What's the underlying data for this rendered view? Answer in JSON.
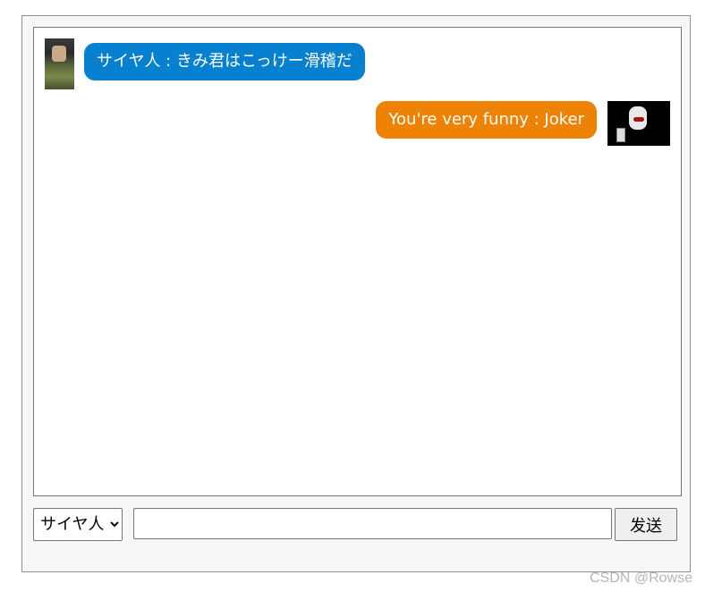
{
  "messages": [
    {
      "side": "left",
      "text": "サイヤ人 : きみ君はこっけー滑稽だ",
      "avatar_icon": "saiyan-avatar"
    },
    {
      "side": "right",
      "text": "You're very funny : Joker",
      "avatar_icon": "joker-avatar"
    }
  ],
  "controls": {
    "speaker_options": [
      "サイヤ人"
    ],
    "speaker_selected": "サイヤ人",
    "message_value": "",
    "send_label": "发送"
  },
  "watermark": "CSDN @Rowse",
  "colors": {
    "left_bubble": "#0780d0",
    "right_bubble": "#ee8205"
  }
}
